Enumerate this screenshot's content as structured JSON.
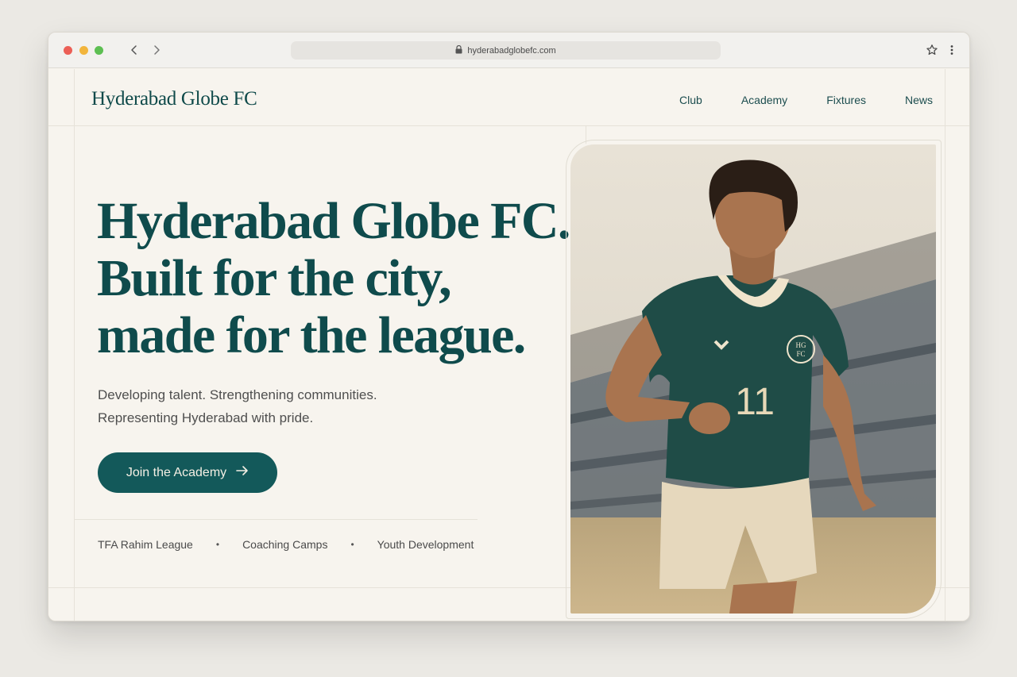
{
  "browser": {
    "url": "hyderabadglobefc.com",
    "icons": [
      "back-arrow-icon",
      "forward-arrow-icon",
      "lock-icon",
      "star-icon",
      "more-icon"
    ]
  },
  "header": {
    "brand": "Hyderabad Globe FC",
    "nav": [
      "Club",
      "Academy",
      "Fixtures",
      "News"
    ]
  },
  "hero": {
    "title_lines": [
      "Hyderabad Globe FC.",
      "Built for the city,",
      "made for the league."
    ],
    "subtitle_lines": [
      "Developing talent. Strengthening communities.",
      "Representing Hyderabad with pride."
    ],
    "cta_label": "Join the Academy",
    "tags": [
      "TFA Rahim League",
      "Coaching Camps",
      "Youth Development"
    ]
  },
  "photo": {
    "crest_lines": [
      "HG",
      "FC"
    ],
    "shirt_number": "11"
  },
  "colors": {
    "brand_green": "#0f4b4c",
    "cta_green": "#13595a",
    "page_bg": "#f7f4ee"
  }
}
